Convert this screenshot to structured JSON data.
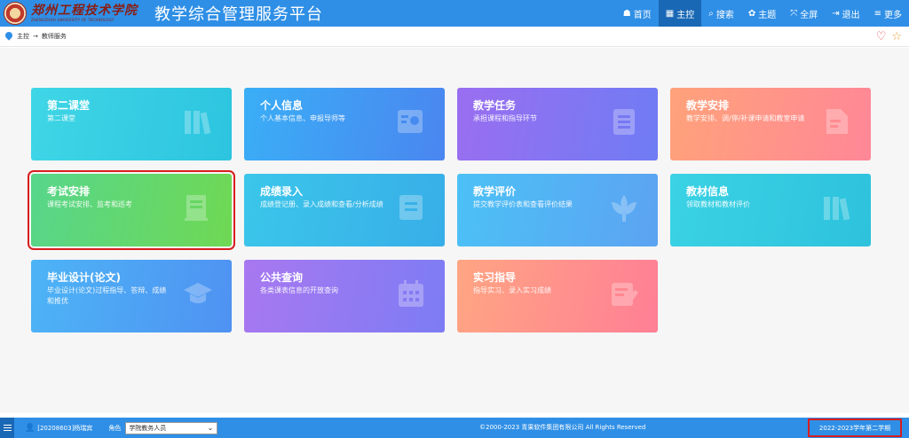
{
  "header": {
    "logo_text": "郑州工程技术学院",
    "logo_en": "ZHENGZHOU UNIVERSITY OF TECHNOLOGY",
    "app_title": "教学综合管理服务平台",
    "nav": [
      {
        "label": "首页",
        "icon": "home-icon",
        "glyph": "☗",
        "active": false
      },
      {
        "label": "主控",
        "icon": "dashboard-icon",
        "glyph": "▦",
        "active": true
      },
      {
        "label": "搜索",
        "icon": "search-icon",
        "glyph": "⌕",
        "active": false
      },
      {
        "label": "主题",
        "icon": "theme-icon",
        "glyph": "✿",
        "active": false
      },
      {
        "label": "全屏",
        "icon": "fullscreen-icon",
        "glyph": "⤧",
        "active": false
      },
      {
        "label": "退出",
        "icon": "logout-icon",
        "glyph": "⇥",
        "active": false
      },
      {
        "label": "更多",
        "icon": "more-icon",
        "glyph": "≡",
        "active": false
      }
    ]
  },
  "breadcrumb": {
    "root": "主控",
    "separator": "→",
    "current": "教师服务"
  },
  "tiles": [
    {
      "title": "第二课堂",
      "desc": "第二课堂",
      "icon": "books-icon",
      "gradient": [
        "#3fd6e6",
        "#2dc4e0"
      ]
    },
    {
      "title": "个人信息",
      "desc": "个人基本信息、申报导师等",
      "icon": "profile-card-icon",
      "gradient": [
        "#3aaef6",
        "#4a86f0"
      ]
    },
    {
      "title": "教学任务",
      "desc": "承担课程和指导环节",
      "icon": "task-list-icon",
      "gradient": [
        "#9a6ef0",
        "#6f7cf4"
      ]
    },
    {
      "title": "教学安排",
      "desc": "教学安排、调/停/补课申请和教室申请",
      "icon": "document-edit-icon",
      "gradient": [
        "#ffa27a",
        "#ff8797"
      ]
    },
    {
      "title": "考试安排",
      "desc": "课程考试安排、监考和巡考",
      "icon": "exam-paper-icon",
      "gradient": [
        "#57d68b",
        "#6fd854"
      ],
      "selected": true
    },
    {
      "title": "成绩录入",
      "desc": "成绩登记册、录入成绩和查看/分析成绩",
      "icon": "grade-card-icon",
      "gradient": [
        "#3bc6ea",
        "#38aee8"
      ]
    },
    {
      "title": "教学评价",
      "desc": "提交教学评价表和查看评价结果",
      "icon": "lotus-icon",
      "gradient": [
        "#4cc1f6",
        "#5ca3f2"
      ]
    },
    {
      "title": "教材信息",
      "desc": "领取教材和教材评价",
      "icon": "books-icon",
      "gradient": [
        "#3ad2e4",
        "#2ec2dd"
      ]
    },
    {
      "title": "毕业设计(论文)",
      "desc": "毕业设计(论文)过程指导、答辩、成绩和推优",
      "icon": "graduation-cap-icon",
      "gradient": [
        "#4db4f6",
        "#4f92f2"
      ]
    },
    {
      "title": "公共查询",
      "desc": "各类课表信息的开放查询",
      "icon": "calendar-icon",
      "gradient": [
        "#a878f0",
        "#7d7cf4"
      ]
    },
    {
      "title": "实习指导",
      "desc": "指导实习、录入实习成绩",
      "icon": "note-edit-icon",
      "gradient": [
        "#ffa583",
        "#ff7f95"
      ]
    }
  ],
  "footer": {
    "user": "[20208603]杨瑞宾",
    "role_label": "角色",
    "role_value": "学院教务人员",
    "copyright": "©2000-2023 青果软件集团有限公司 All Rights Reserved",
    "term": "2022-2023学年第二学期"
  }
}
